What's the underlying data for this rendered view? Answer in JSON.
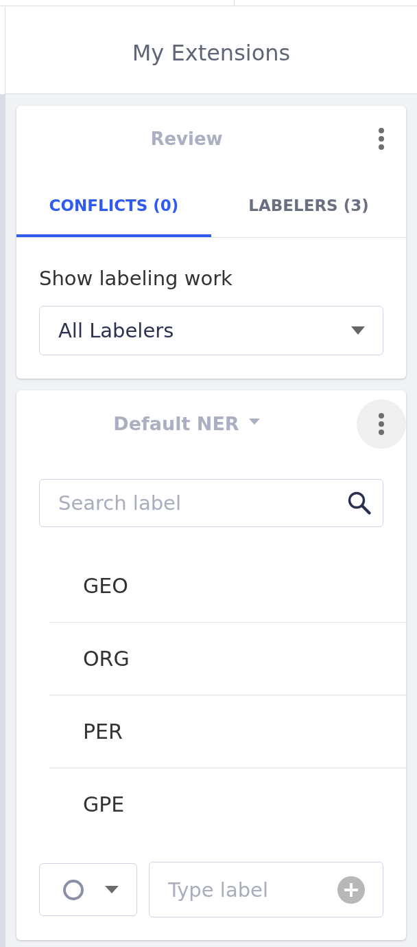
{
  "header": {
    "title": "My Extensions"
  },
  "review_card": {
    "title": "Review",
    "menu_button": {
      "highlighted": false
    },
    "tabs": [
      {
        "label": "CONFLICTS (0)",
        "selected": true
      },
      {
        "label": "LABELERS (3)",
        "selected": false
      }
    ],
    "filter": {
      "label": "Show labeling work",
      "value": "All Labelers"
    }
  },
  "labels_card": {
    "title": "Default NER",
    "menu_button": {
      "highlighted": true
    },
    "search": {
      "placeholder": "Search label"
    },
    "labels": [
      "GEO",
      "ORG",
      "PER",
      "GPE"
    ],
    "new_label": {
      "placeholder": "Type label"
    }
  }
}
